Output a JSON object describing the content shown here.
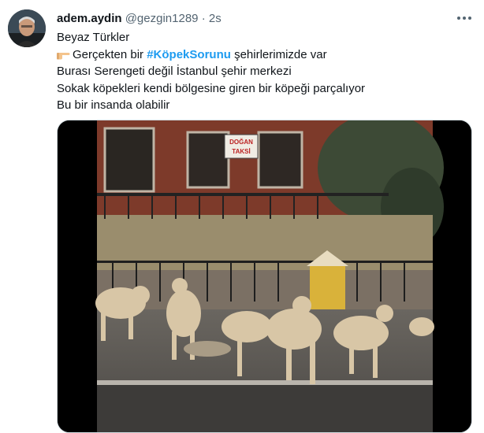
{
  "tweet": {
    "author_name": "adem.aydin",
    "author_handle": "@gezgin1289",
    "separator": "·",
    "timestamp": "2s",
    "more_icon": "more-horizontal-icon",
    "lines": {
      "l1": "Beyaz Türkler",
      "l2_before": "Gerçekten bir ",
      "l2_hashtag": "#KöpekSorunu",
      "l2_after": " şehirlerimizde var",
      "l3": "Burası Serengeti değil İstanbul şehir merkezi",
      "l4": "Sokak köpekleri kendi bölgesine giren bir köpeği parçalıyor",
      "l5": "Bu bir insanda olabilir"
    },
    "emoji_icon": "pointing-hand-emoji",
    "video": {
      "sign_text_1": "DOĞAN",
      "sign_text_2": "TAKSİ"
    },
    "colors": {
      "hashtag": "#1d9bf0",
      "secondary_text": "#536471"
    }
  }
}
